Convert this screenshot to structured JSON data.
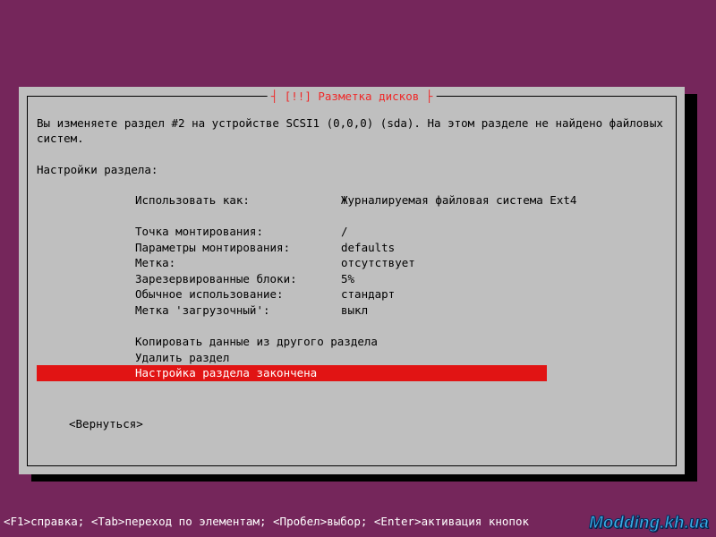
{
  "colors": {
    "background": "#75265b",
    "panel": "#bfbfbf",
    "highlight": "#e11414",
    "title": "#ef2929"
  },
  "dialog": {
    "title": "┤ [!!] Разметка дисков ├",
    "intro": "Вы изменяете раздел #2 на устройстве SCSI1 (0,0,0) (sda). На этом разделе не найдено файловых систем.",
    "section_label": "Настройки раздела:",
    "settings": [
      {
        "label": "Использовать как:",
        "value": "Журналируемая файловая система Ext4"
      },
      {
        "label": "",
        "value": ""
      },
      {
        "label": "Точка монтирования:",
        "value": "/"
      },
      {
        "label": "Параметры монтирования:",
        "value": "defaults"
      },
      {
        "label": "Метка:",
        "value": "отсутствует"
      },
      {
        "label": "Зарезервированные блоки:",
        "value": "5%"
      },
      {
        "label": "Обычное использование:",
        "value": "стандарт"
      },
      {
        "label": "Метка 'загрузочный':",
        "value": "выкл"
      }
    ],
    "actions": {
      "copy": "Копировать данные из другого раздела",
      "delete": "Удалить раздел",
      "done": "Настройка раздела закончена"
    },
    "back_label": "<Вернуться>"
  },
  "helpbar": "<F1>справка; <Tab>переход по элементам; <Пробел>выбор; <Enter>активация кнопок",
  "watermark": "Modding.kh.ua"
}
